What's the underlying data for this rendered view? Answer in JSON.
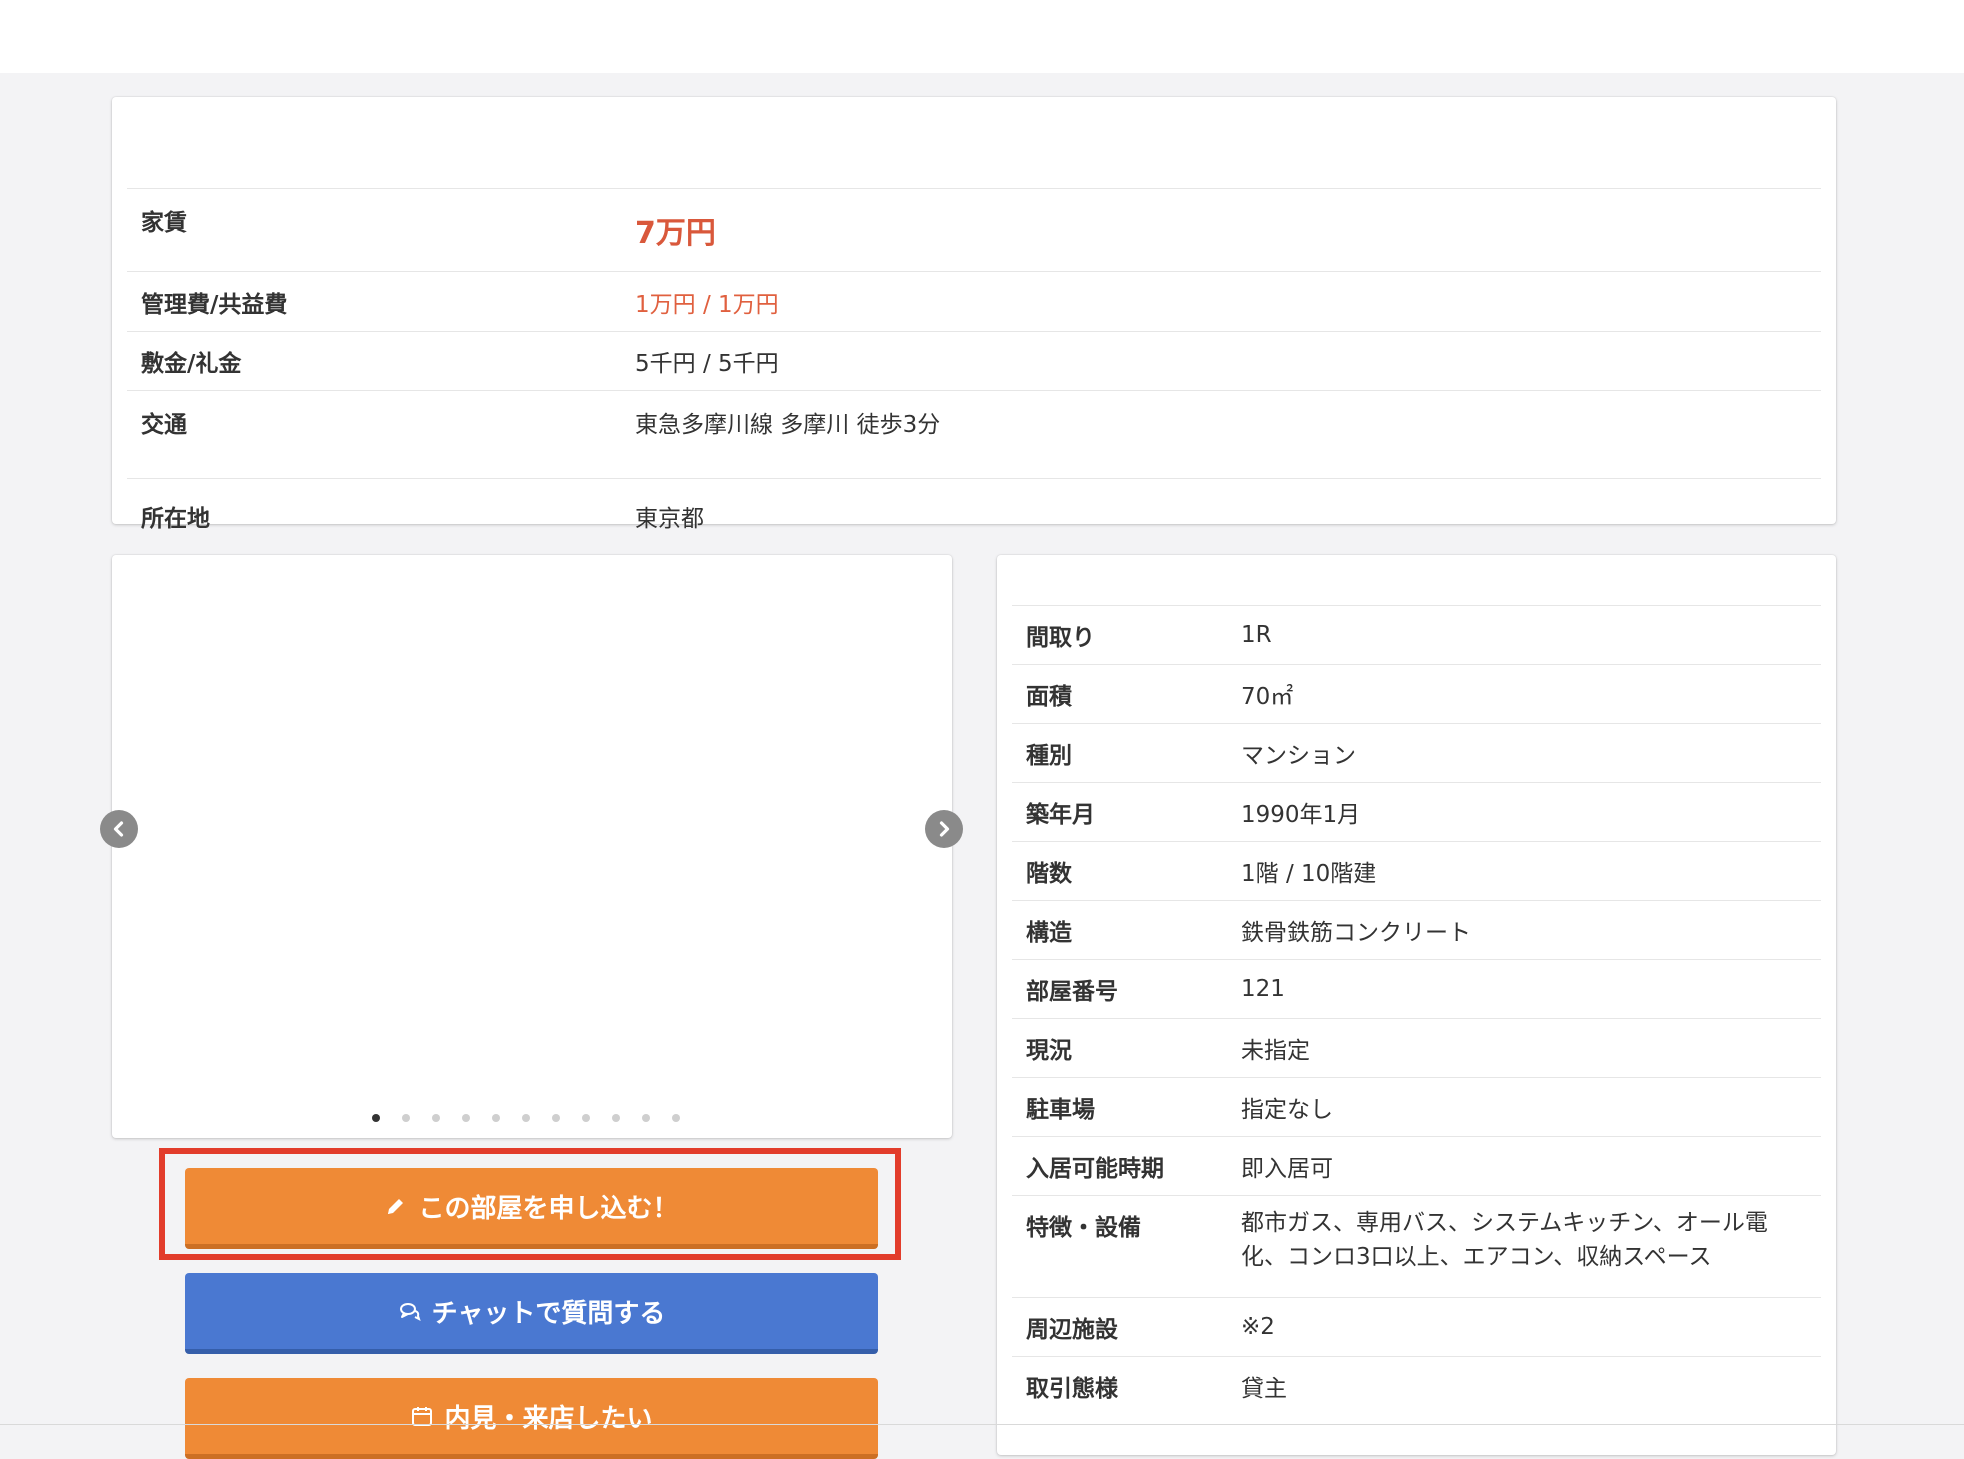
{
  "summary": {
    "rows": [
      {
        "label": "家賃",
        "value": "7万円"
      },
      {
        "label": "管理費/共益費",
        "value": "1万円 / 1万円"
      },
      {
        "label": "敷金/礼金",
        "value": "5千円 / 5千円"
      },
      {
        "label": "交通",
        "value": "東急多摩川線 多摩川 徒歩3分"
      },
      {
        "label": "所在地",
        "value": "東京都"
      }
    ]
  },
  "gallery": {
    "slide_count": 11,
    "active_index": 0
  },
  "actions": {
    "apply_label": "この部屋を申し込む！",
    "chat_label": "チャットで質問する",
    "visit_label": "内見・来店したい"
  },
  "specs": {
    "rows": [
      {
        "label": "間取り",
        "value": "1R"
      },
      {
        "label": "面積",
        "value": "70㎡"
      },
      {
        "label": "種別",
        "value": "マンション"
      },
      {
        "label": "築年月",
        "value": "1990年1月"
      },
      {
        "label": "階数",
        "value": "1階 / 10階建"
      },
      {
        "label": "構造",
        "value": "鉄骨鉄筋コンクリート"
      },
      {
        "label": "部屋番号",
        "value": "121"
      },
      {
        "label": "現況",
        "value": "未指定"
      },
      {
        "label": "駐車場",
        "value": "指定なし"
      },
      {
        "label": "入居可能時期",
        "value": "即入居可"
      },
      {
        "label": "特徴・設備",
        "value": "都市ガス、専用バス、システムキッチン、オール電化、コンロ3口以上、エアコン、収納スペース"
      },
      {
        "label": "周辺施設",
        "value": "※2"
      },
      {
        "label": "取引態様",
        "value": "貸主"
      }
    ]
  },
  "icons": {
    "apply": "pencil-icon",
    "chat": "chat-bubbles-icon",
    "visit": "calendar-icon",
    "prev": "chevron-left-icon",
    "next": "chevron-right-icon"
  },
  "colors": {
    "price_accent": "#d9583b",
    "apply_button": "#ef8a36",
    "chat_button": "#4a78d1",
    "highlight_border": "#e23c2b"
  }
}
